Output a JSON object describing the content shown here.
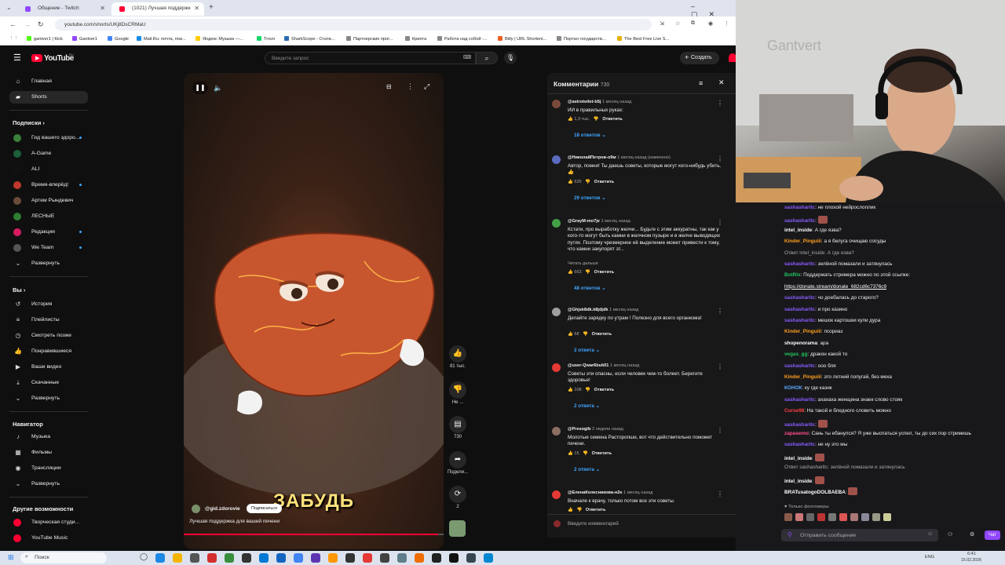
{
  "browser": {
    "tabs": [
      {
        "title": "Общение - Twitch",
        "active": false
      },
      {
        "title": "(1021) Лучшая поддержк",
        "active": true
      }
    ],
    "url": "youtube.com/shorts/UKj8DsCRMaU",
    "bookmarks": [
      "gantver1 | Kick",
      "Gantver1",
      "Google",
      "Mail.Ru: почта, пои...",
      "Яндекс Музыка —...",
      "Trovo",
      "SharkScope - Стати...",
      "Партнерские прог...",
      "Крипта",
      "Работа над собой -...",
      "Bitly | URL Shorteni...",
      "Портал государств...",
      "The Best Free Live S..."
    ]
  },
  "youtube": {
    "logo": "YouTube",
    "logo_country": "RU",
    "search_placeholder": "Введите запрос",
    "create_label": "Создать",
    "sidebar": {
      "main": [
        "Главная",
        "Shorts"
      ],
      "subs_title": "Подписки",
      "subs": [
        {
          "name": "Гид вашего здоро...",
          "color": "#3a7f3a",
          "dot": true
        },
        {
          "name": "A-Game",
          "color": "#1c5f3a",
          "dot": false
        },
        {
          "name": "ALI",
          "color": "#111111",
          "dot": false
        },
        {
          "name": "Время-вперёд!",
          "color": "#c0392b",
          "dot": true
        },
        {
          "name": "Артем Рындевич",
          "color": "#6a4a3a",
          "dot": false
        },
        {
          "name": "ЛЕСНЫЕ",
          "color": "#2e7d32",
          "dot": false
        },
        {
          "name": "Редакция",
          "color": "#d81b60",
          "dot": true
        },
        {
          "name": "We Team",
          "color": "#555555",
          "dot": true
        }
      ],
      "expand": "Развернуть",
      "you_title": "Вы",
      "you": [
        "История",
        "Плейлисты",
        "Смотреть позже",
        "Понравившиеся",
        "Ваши видео",
        "Скачанные",
        "Развернуть"
      ],
      "nav_title": "Навигатор",
      "nav": [
        "Музыка",
        "Фильмы",
        "Трансляции",
        "Развернуть"
      ],
      "more_title": "Другие возможности",
      "more": [
        "Творческая студи...",
        "YouTube Music"
      ]
    },
    "short": {
      "caption": "ЗАБУДЬ",
      "channel": "@gid.zdorovie",
      "subscribe": "Подписаться",
      "title": "Лучшая поддержка для вашей печени",
      "progress": 0.98,
      "actions": [
        {
          "icon": "like",
          "label": "81 тыс."
        },
        {
          "icon": "dislike",
          "label": "Не ..."
        },
        {
          "icon": "comment",
          "label": "730"
        },
        {
          "icon": "share",
          "label": "Подели..."
        },
        {
          "icon": "remix",
          "label": "2"
        }
      ]
    },
    "comments": {
      "title": "Комментарии",
      "count": "730",
      "items": [
        {
          "author": "@astrotoilet-b5j",
          "time": "1 месяц назад",
          "text": "ИИ в правильных руках:",
          "likes": "1,3 тыс.",
          "replies": "18 ответов",
          "color": "#7a4a3a"
        },
        {
          "author": "@НиколайПетров-о9м",
          "time": "1 месяц назад (изменено)",
          "text": "Автор, помни! Ты даешь советы, которые могут кого-нибудь убить. 👍",
          "likes": "625",
          "replies": "29 ответов",
          "color": "#5c6bc0"
        },
        {
          "author": "@GrayM-mo7je",
          "time": "1 месяц назад",
          "text": "Кстати, про выработку желчи... Будьте с этим аккуратны, так как у кого-то могут быть камни в желчном пузыре и в желче выводящих путях. Поэтому чрезмерное её выделение может привести к тому, что камни закупорят эт...",
          "more": "Читать дальше",
          "likes": "663",
          "replies": "48 ответов",
          "color": "#43a047"
        },
        {
          "author": "@Ghjsk8dk.k8jdjdk",
          "time": "1 месяц назад",
          "text": "Делайте зарядку по утрам ! Полезно для всего организма!",
          "likes": "68",
          "replies": "2 ответа",
          "color": "#9e9e9e"
        },
        {
          "author": "@user-Qwar6buk01",
          "time": "1 месяц назад",
          "text": "Советы эти опасны, если человек чем-то болеет. Берегите здоровье!",
          "likes": "108",
          "replies": "2 ответа",
          "color": "#e53935"
        },
        {
          "author": "@Presogib",
          "time": "2 недели назад",
          "text": "Молотые семена Расторопши, вот что действительно поможет печени.",
          "likes": "15",
          "replies": "2 ответа",
          "color": "#8d6e63"
        },
        {
          "author": "@ЕленаКолесникова-н2е",
          "time": "1 месяц назад",
          "text": "Вначале к врачу, только потом все эти советы.",
          "likes": "",
          "replies": "",
          "color": "#e53935"
        }
      ],
      "reply_label": "Ответить",
      "input_placeholder": "Введите комментарий"
    }
  },
  "twitch": {
    "watermark": "Gantvert",
    "chat": [
      {
        "user": "sashasharitc",
        "color": "#8a5cff",
        "msg": "не плохой нейрослоплик"
      },
      {
        "user": "sashasharitc",
        "color": "#8a5cff",
        "msg": "[emote]"
      },
      {
        "user": "intel_inside",
        "color": "#ffffff",
        "msg": "А где язва?"
      },
      {
        "user": "Kinder_Pinguiii",
        "color": "#ff9f1c",
        "msg": "а я белуга очищаю сосуды"
      },
      {
        "user": "",
        "color": "#aaaaaa",
        "msg": "Ответ intel_inside: А где язва?"
      },
      {
        "user": "sashasharitc",
        "color": "#8a5cff",
        "msg": "зелёной помазали и затянулась"
      },
      {
        "user": "BotRix",
        "color": "#21c45d",
        "msg": "Поддержать стримера можно по этой ссылке:"
      },
      {
        "user": "",
        "color": "#ffffff",
        "msg": "https://donate.stream/donate_682cd6c7376c9"
      },
      {
        "user": "sashasharitc",
        "color": "#8a5cff",
        "msg": "чо доебалась до старого?"
      },
      {
        "user": "sashasharitc",
        "color": "#8a5cff",
        "msg": "и про казино"
      },
      {
        "user": "sashasharitc",
        "color": "#8a5cff",
        "msg": "мешок картошки купи дура"
      },
      {
        "user": "Kinder_Pinguiii",
        "color": "#ff9f1c",
        "msg": "псориаз"
      },
      {
        "user": "shopenorama",
        "color": "#ffffff",
        "msg": "ара"
      },
      {
        "user": "vegas_gg",
        "color": "#21c45d",
        "msg": "дракон какой то"
      },
      {
        "user": "sashasharitc",
        "color": "#8a5cff",
        "msg": "ооо бля"
      },
      {
        "user": "Kinder_Pinguiii",
        "color": "#ff9f1c",
        "msg": "это летний попугай, без меха"
      },
      {
        "user": "КОНОК",
        "color": "#5aa9ff",
        "msg": "ку где казик"
      },
      {
        "user": "sashasharitc",
        "color": "#8a5cff",
        "msg": "ахахаха женщина знаек слово стояк"
      },
      {
        "user": "Curse98",
        "color": "#ff4040",
        "msg": "На такой и бледного словить можно"
      },
      {
        "user": "sashasharitc",
        "color": "#8a5cff",
        "msg": "[emote]"
      },
      {
        "user": "zapasemo",
        "color": "#ff4d88",
        "msg": "Сань ты ебанулся? Я уже выспаться успел, ты до сих пор стримишь"
      },
      {
        "user": "sashasharitc",
        "color": "#8a5cff",
        "msg": "не ну это мы"
      },
      {
        "user": "intel_inside",
        "color": "#ffffff",
        "msg": "[emote]"
      },
      {
        "user": "",
        "color": "#aaaaaa",
        "msg": "Ответ sashasharitc: зелёной помазали и затянулась"
      },
      {
        "user": "intel_inside",
        "color": "#ffffff",
        "msg": "[emote]"
      },
      {
        "user": "BRATusatogoDOLBAEBA",
        "color": "#ffffff",
        "msg": "[emote]"
      }
    ],
    "followers_only": "Только фолловеры",
    "chat_placeholder": "Отправить сообщение",
    "chat_button": "Чат"
  },
  "taskbar": {
    "search": "Поиск",
    "lang": "ENG",
    "time": "6:41",
    "date": "15.02.2026"
  }
}
